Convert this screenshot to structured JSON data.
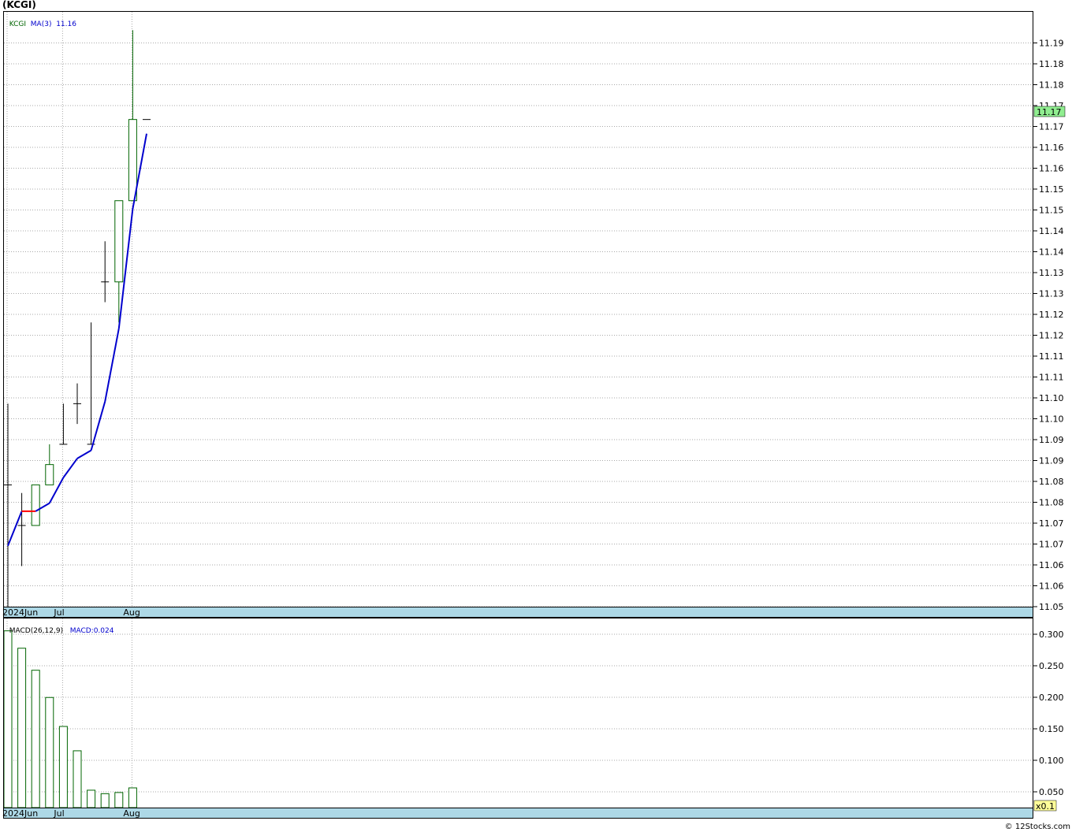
{
  "title": "(KCGI)",
  "credit": "© 12Stocks.com",
  "colors": {
    "grid": "#a9a9a9",
    "frame": "#000000",
    "date_band": "#add8e6",
    "candle": "#006400",
    "ma_up": "#0000cd",
    "ma_down": "#ff0000",
    "price_tag": "#90ee90",
    "scale_tag": "#ffff99"
  },
  "price_panel": {
    "legend": {
      "symbol": "KCGI",
      "ma_label": "MA(3)",
      "ma_value": "11.16"
    },
    "current_price_label": "11.17"
  },
  "macd_panel": {
    "legend": {
      "label": "MACD(26,12,9)",
      "value_label": "MACD:0.024"
    },
    "scale_label": "x0.1"
  },
  "chart_data": [
    {
      "type": "candlestick",
      "xlabels": [
        {
          "label": "2024Jun",
          "index": 0
        },
        {
          "label": "Jul",
          "index": 4
        },
        {
          "label": "Aug",
          "index": 9
        }
      ],
      "y_ticks": [
        "11.05",
        "11.06",
        "11.06",
        "11.07",
        "11.07",
        "11.08",
        "11.08",
        "11.09",
        "11.09",
        "11.10",
        "11.10",
        "11.11",
        "11.11",
        "11.12",
        "11.12",
        "11.13",
        "11.13",
        "11.14",
        "11.14",
        "11.15",
        "11.15",
        "11.16",
        "11.16",
        "11.17",
        "11.17",
        "11.18",
        "11.18",
        "11.19"
      ],
      "ylim": [
        11.05,
        11.194
      ],
      "candles": [
        {
          "o": 11.08,
          "h": 11.1,
          "l": 11.05,
          "c": 11.08
        },
        {
          "o": 11.07,
          "h": 11.078,
          "l": 11.06,
          "c": 11.07
        },
        {
          "o": 11.07,
          "h": 11.08,
          "l": 11.07,
          "c": 11.08
        },
        {
          "o": 11.08,
          "h": 11.09,
          "l": 11.08,
          "c": 11.085
        },
        {
          "o": 11.09,
          "h": 11.1,
          "l": 11.09,
          "c": 11.09
        },
        {
          "o": 11.1,
          "h": 11.105,
          "l": 11.095,
          "c": 11.1
        },
        {
          "o": 11.09,
          "h": 11.12,
          "l": 11.09,
          "c": 11.09
        },
        {
          "o": 11.13,
          "h": 11.14,
          "l": 11.125,
          "c": 11.13
        },
        {
          "o": 11.13,
          "h": 11.15,
          "l": 11.12,
          "c": 11.15
        },
        {
          "o": 11.15,
          "h": 11.192,
          "l": 11.15,
          "c": 11.17
        },
        {
          "o": 11.17,
          "h": 11.17,
          "l": 11.17,
          "c": 11.17
        }
      ],
      "ma": [
        11.065,
        11.0735,
        11.0735,
        11.0755,
        11.0818,
        11.0865,
        11.0885,
        11.1005,
        11.1185,
        11.148,
        11.1665
      ]
    },
    {
      "type": "bar",
      "title": "MACD(26,12,9)",
      "xlabels": [
        {
          "label": "2024Jun",
          "index": 0
        },
        {
          "label": "Jul",
          "index": 4
        },
        {
          "label": "Aug",
          "index": 9
        }
      ],
      "y_ticks": [
        "0.050",
        "0.100",
        "0.150",
        "0.200",
        "0.250",
        "0.300"
      ],
      "ylim": [
        0,
        0.31
      ],
      "values": [
        0.305,
        0.275,
        0.237,
        0.19,
        0.14,
        0.098,
        0.03,
        0.024,
        0.026,
        0.034
      ]
    }
  ]
}
